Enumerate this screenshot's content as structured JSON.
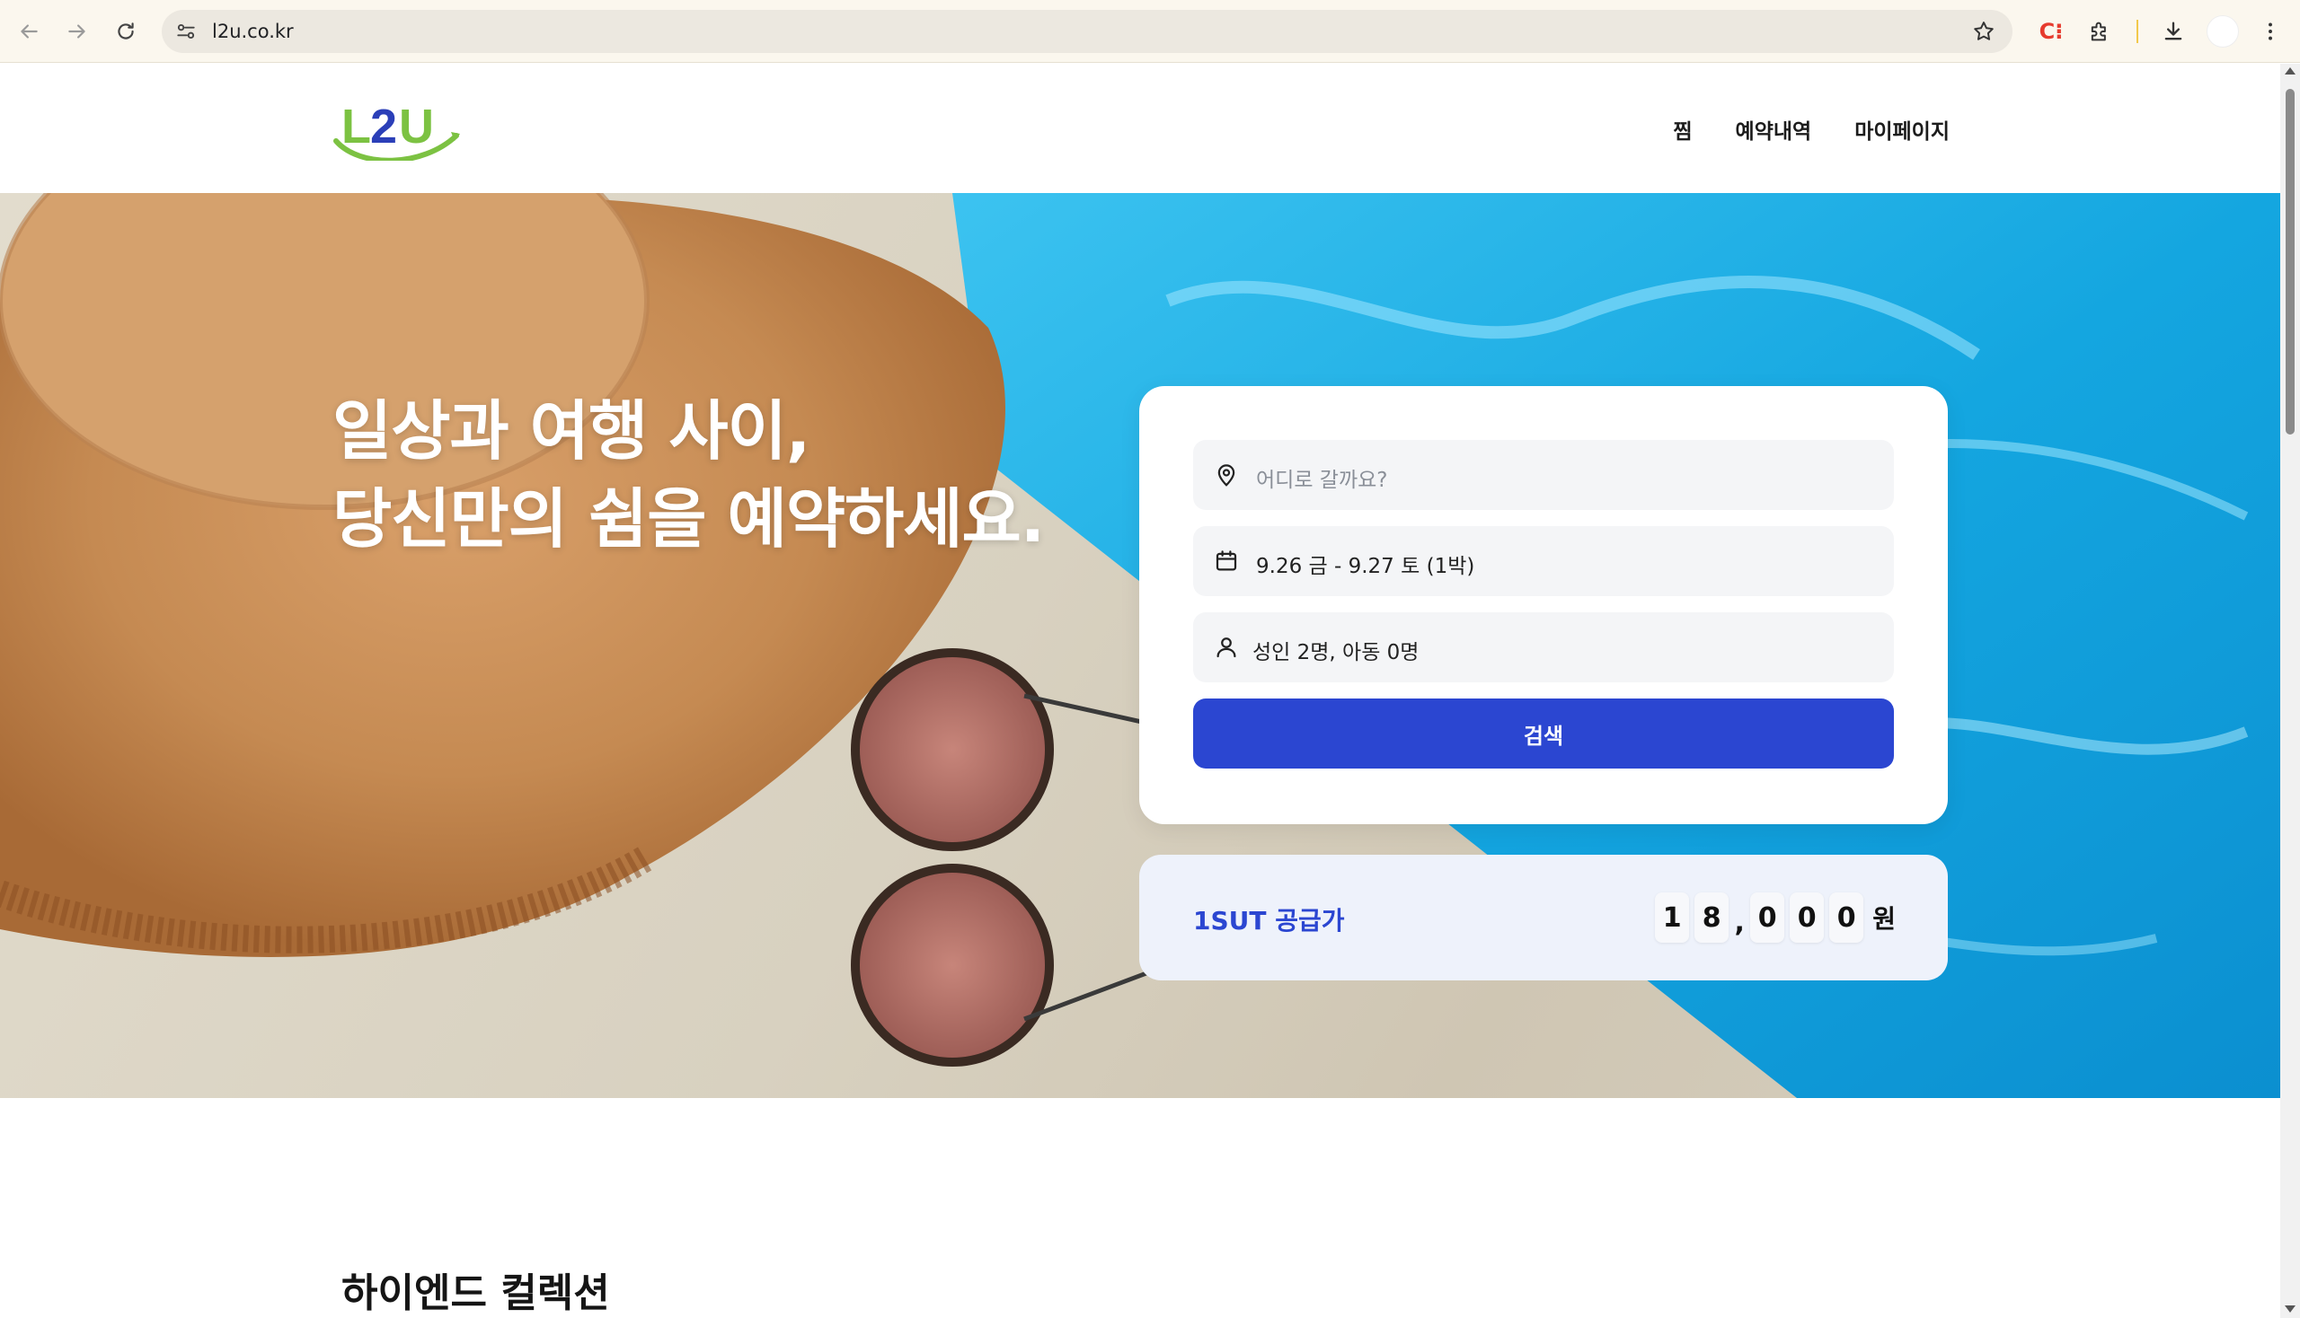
{
  "browser": {
    "url": "l2u.co.kr",
    "icons": [
      "back-icon",
      "forward-icon",
      "reload-icon",
      "site-settings-icon",
      "bookmark-star-icon",
      "extension-c-icon",
      "extensions-puzzle-icon",
      "download-icon",
      "profile-avatar",
      "more-menu-icon"
    ],
    "ext_c_label": "C⁝"
  },
  "header": {
    "logo_text": "L2U",
    "logo_colors": {
      "letters": "#2b3fb8",
      "swoosh": "#7cc242"
    },
    "menu": [
      {
        "label": "찜"
      },
      {
        "label": "예약내역"
      },
      {
        "label": "마이페이지"
      }
    ]
  },
  "hero": {
    "title_line1": "일상과 여행 사이,",
    "title_line2": "당신만의 쉼을 예약하세요."
  },
  "search": {
    "destination_placeholder": "어디로 갈까요?",
    "dates": "9.26 금 - 9.27 토 (1박)",
    "guests": "성인 2명, 아동 0명",
    "button_label": "검색",
    "accent_color": "#2b46d1"
  },
  "price": {
    "label": "1SUT 공급가",
    "digits": [
      "1",
      "8",
      "0",
      "0",
      "0"
    ],
    "separator": ",",
    "currency": "원"
  },
  "section": {
    "title": "하이엔드 컬렉션"
  }
}
